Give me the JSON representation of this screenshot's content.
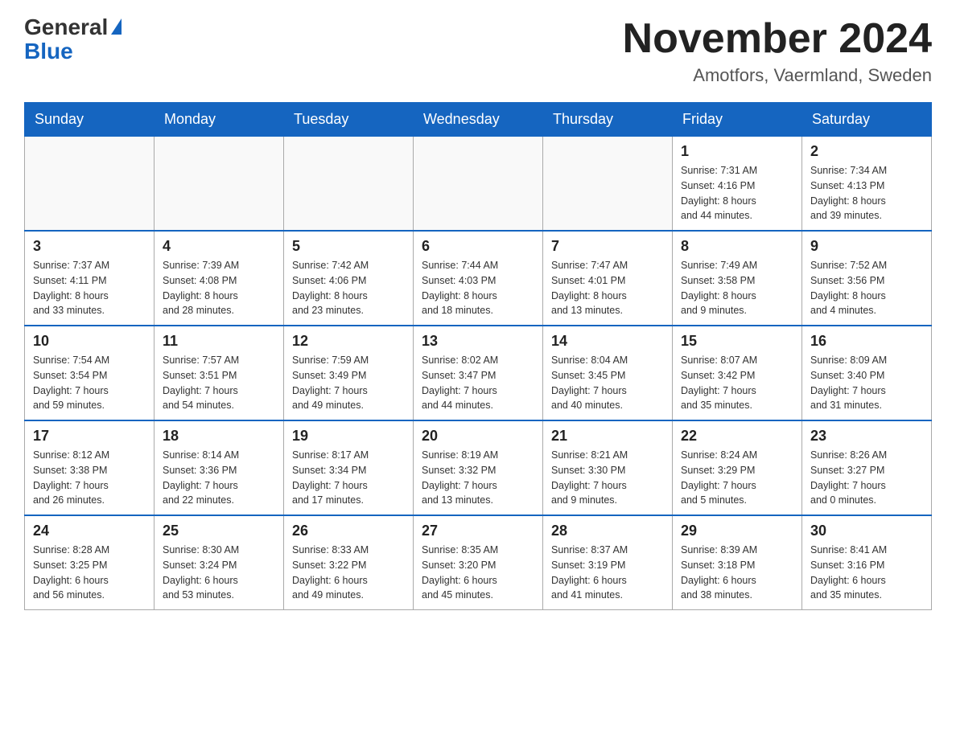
{
  "header": {
    "logo_general": "General",
    "logo_blue": "Blue",
    "month_title": "November 2024",
    "location": "Amotfors, Vaermland, Sweden"
  },
  "weekdays": [
    "Sunday",
    "Monday",
    "Tuesday",
    "Wednesday",
    "Thursday",
    "Friday",
    "Saturday"
  ],
  "weeks": [
    [
      {
        "day": "",
        "info": ""
      },
      {
        "day": "",
        "info": ""
      },
      {
        "day": "",
        "info": ""
      },
      {
        "day": "",
        "info": ""
      },
      {
        "day": "",
        "info": ""
      },
      {
        "day": "1",
        "info": "Sunrise: 7:31 AM\nSunset: 4:16 PM\nDaylight: 8 hours\nand 44 minutes."
      },
      {
        "day": "2",
        "info": "Sunrise: 7:34 AM\nSunset: 4:13 PM\nDaylight: 8 hours\nand 39 minutes."
      }
    ],
    [
      {
        "day": "3",
        "info": "Sunrise: 7:37 AM\nSunset: 4:11 PM\nDaylight: 8 hours\nand 33 minutes."
      },
      {
        "day": "4",
        "info": "Sunrise: 7:39 AM\nSunset: 4:08 PM\nDaylight: 8 hours\nand 28 minutes."
      },
      {
        "day": "5",
        "info": "Sunrise: 7:42 AM\nSunset: 4:06 PM\nDaylight: 8 hours\nand 23 minutes."
      },
      {
        "day": "6",
        "info": "Sunrise: 7:44 AM\nSunset: 4:03 PM\nDaylight: 8 hours\nand 18 minutes."
      },
      {
        "day": "7",
        "info": "Sunrise: 7:47 AM\nSunset: 4:01 PM\nDaylight: 8 hours\nand 13 minutes."
      },
      {
        "day": "8",
        "info": "Sunrise: 7:49 AM\nSunset: 3:58 PM\nDaylight: 8 hours\nand 9 minutes."
      },
      {
        "day": "9",
        "info": "Sunrise: 7:52 AM\nSunset: 3:56 PM\nDaylight: 8 hours\nand 4 minutes."
      }
    ],
    [
      {
        "day": "10",
        "info": "Sunrise: 7:54 AM\nSunset: 3:54 PM\nDaylight: 7 hours\nand 59 minutes."
      },
      {
        "day": "11",
        "info": "Sunrise: 7:57 AM\nSunset: 3:51 PM\nDaylight: 7 hours\nand 54 minutes."
      },
      {
        "day": "12",
        "info": "Sunrise: 7:59 AM\nSunset: 3:49 PM\nDaylight: 7 hours\nand 49 minutes."
      },
      {
        "day": "13",
        "info": "Sunrise: 8:02 AM\nSunset: 3:47 PM\nDaylight: 7 hours\nand 44 minutes."
      },
      {
        "day": "14",
        "info": "Sunrise: 8:04 AM\nSunset: 3:45 PM\nDaylight: 7 hours\nand 40 minutes."
      },
      {
        "day": "15",
        "info": "Sunrise: 8:07 AM\nSunset: 3:42 PM\nDaylight: 7 hours\nand 35 minutes."
      },
      {
        "day": "16",
        "info": "Sunrise: 8:09 AM\nSunset: 3:40 PM\nDaylight: 7 hours\nand 31 minutes."
      }
    ],
    [
      {
        "day": "17",
        "info": "Sunrise: 8:12 AM\nSunset: 3:38 PM\nDaylight: 7 hours\nand 26 minutes."
      },
      {
        "day": "18",
        "info": "Sunrise: 8:14 AM\nSunset: 3:36 PM\nDaylight: 7 hours\nand 22 minutes."
      },
      {
        "day": "19",
        "info": "Sunrise: 8:17 AM\nSunset: 3:34 PM\nDaylight: 7 hours\nand 17 minutes."
      },
      {
        "day": "20",
        "info": "Sunrise: 8:19 AM\nSunset: 3:32 PM\nDaylight: 7 hours\nand 13 minutes."
      },
      {
        "day": "21",
        "info": "Sunrise: 8:21 AM\nSunset: 3:30 PM\nDaylight: 7 hours\nand 9 minutes."
      },
      {
        "day": "22",
        "info": "Sunrise: 8:24 AM\nSunset: 3:29 PM\nDaylight: 7 hours\nand 5 minutes."
      },
      {
        "day": "23",
        "info": "Sunrise: 8:26 AM\nSunset: 3:27 PM\nDaylight: 7 hours\nand 0 minutes."
      }
    ],
    [
      {
        "day": "24",
        "info": "Sunrise: 8:28 AM\nSunset: 3:25 PM\nDaylight: 6 hours\nand 56 minutes."
      },
      {
        "day": "25",
        "info": "Sunrise: 8:30 AM\nSunset: 3:24 PM\nDaylight: 6 hours\nand 53 minutes."
      },
      {
        "day": "26",
        "info": "Sunrise: 8:33 AM\nSunset: 3:22 PM\nDaylight: 6 hours\nand 49 minutes."
      },
      {
        "day": "27",
        "info": "Sunrise: 8:35 AM\nSunset: 3:20 PM\nDaylight: 6 hours\nand 45 minutes."
      },
      {
        "day": "28",
        "info": "Sunrise: 8:37 AM\nSunset: 3:19 PM\nDaylight: 6 hours\nand 41 minutes."
      },
      {
        "day": "29",
        "info": "Sunrise: 8:39 AM\nSunset: 3:18 PM\nDaylight: 6 hours\nand 38 minutes."
      },
      {
        "day": "30",
        "info": "Sunrise: 8:41 AM\nSunset: 3:16 PM\nDaylight: 6 hours\nand 35 minutes."
      }
    ]
  ]
}
